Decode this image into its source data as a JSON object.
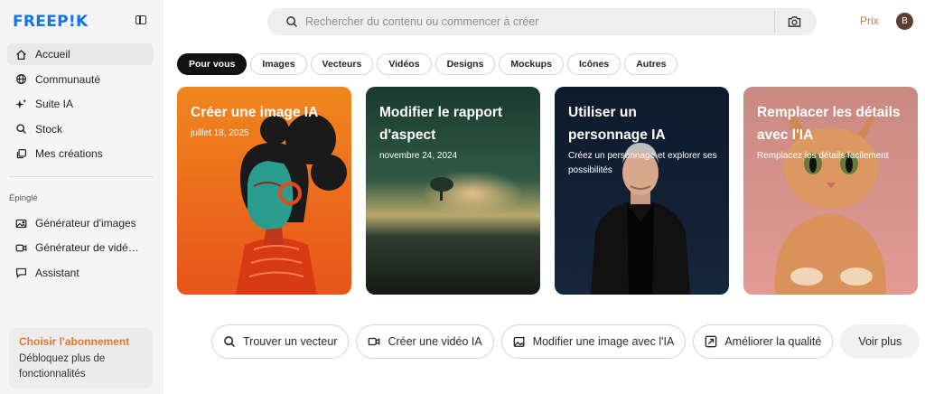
{
  "brand": {
    "logo_text": "FREEP!K",
    "logo_color": "#1273eb"
  },
  "sidebar": {
    "items": [
      {
        "label": "Accueil",
        "icon": "home-icon",
        "active": true
      },
      {
        "label": "Communauté",
        "icon": "globe-icon"
      },
      {
        "label": "Suite IA",
        "icon": "sparkle-icon"
      },
      {
        "label": "Stock",
        "icon": "search-icon"
      },
      {
        "label": "Mes créations",
        "icon": "copy-icon"
      }
    ],
    "pinned_label": "Épinglé",
    "pinned_items": [
      {
        "label": "Générateur d'images",
        "icon": "image-icon"
      },
      {
        "label": "Générateur de vidé…",
        "icon": "video-icon"
      },
      {
        "label": "Assistant",
        "icon": "chat-icon"
      }
    ],
    "subscription": {
      "title": "Choisir l'abonnement",
      "text": "Débloquez plus de fonctionnalités",
      "title_color": "#e0782f"
    }
  },
  "header": {
    "search_placeholder": "Rechercher du contenu ou commencer à créer",
    "price_link": "Prix",
    "price_color": "#c87a3a",
    "avatar_initial": "B"
  },
  "tabs": [
    {
      "label": "Pour vous",
      "active": true
    },
    {
      "label": "Images"
    },
    {
      "label": "Vecteurs"
    },
    {
      "label": "Vidéos"
    },
    {
      "label": "Designs"
    },
    {
      "label": "Mockups"
    },
    {
      "label": "Icônes"
    },
    {
      "label": "Autres"
    }
  ],
  "cards": [
    {
      "title": "Créer une image IA",
      "subtitle": "juillet 18, 2025"
    },
    {
      "title": "Modifier le rapport d'aspect",
      "subtitle": "novembre 24, 2024"
    },
    {
      "title": "Utiliser un personnage IA",
      "subtitle": "Créez un personnage et explorer ses possibilités"
    },
    {
      "title": "Remplacer les détails avec l'IA",
      "subtitle": "Remplacez les détails facilement"
    }
  ],
  "actions": [
    {
      "label": "Trouver un vecteur",
      "icon": "search-icon"
    },
    {
      "label": "Créer une vidéo IA",
      "icon": "video-icon"
    },
    {
      "label": "Modifier une image avec l'IA",
      "icon": "image-edit-icon"
    },
    {
      "label": "Améliorer la qualité",
      "icon": "upscale-icon"
    },
    {
      "label": "Voir plus"
    }
  ]
}
